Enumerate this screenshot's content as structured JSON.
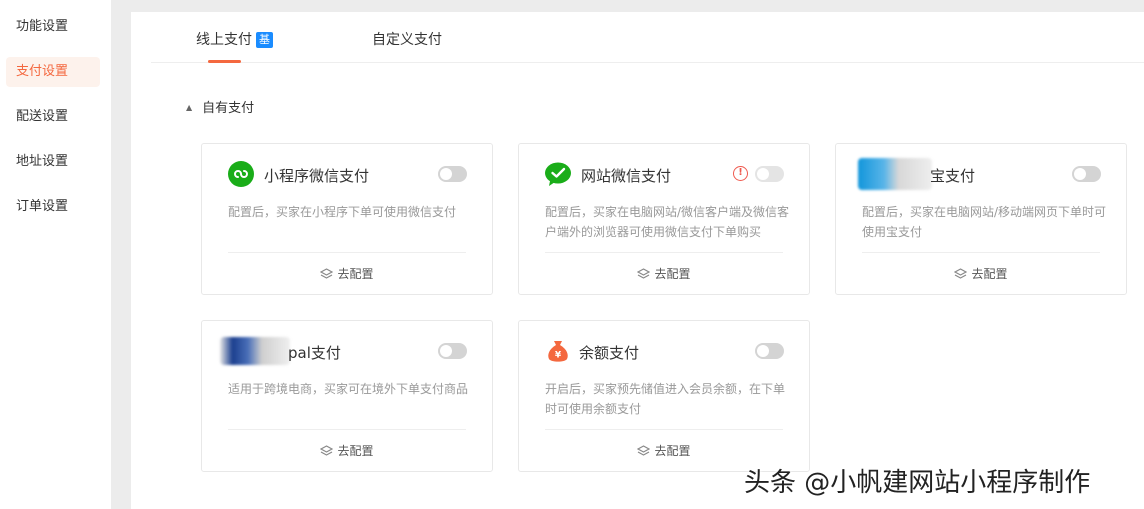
{
  "sidebar": {
    "items": [
      {
        "label": "功能设置"
      },
      {
        "label": "支付设置"
      },
      {
        "label": "配送设置"
      },
      {
        "label": "地址设置"
      },
      {
        "label": "订单设置"
      }
    ]
  },
  "tabs": [
    {
      "label": "线上支付",
      "badge": "基"
    },
    {
      "label": "自定义支付"
    }
  ],
  "section": {
    "label": "自有支付"
  },
  "cards": [
    {
      "title": "小程序微信支付",
      "desc": "配置后，买家在小程序下单可使用微信支付",
      "action": "去配置"
    },
    {
      "title": "网站微信支付",
      "desc": "配置后，买家在电脑网站/微信客户端及微信客户端外的浏览器可使用微信支付下单购买",
      "action": "去配置"
    },
    {
      "title": "宝支付",
      "desc": "配置后，买家在电脑网站/移动端网页下单时可使用宝支付",
      "action": "去配置"
    },
    {
      "title": "pal支付",
      "desc": "适用于跨境电商，买家可在境外下单支付商品",
      "action": "去配置"
    },
    {
      "title": "余额支付",
      "desc": "开启后，买家预先储值进入会员余额，在下单时可使用余额支付",
      "action": "去配置"
    }
  ],
  "watermark": "头条 @小帆建网站小程序制作",
  "colors": {
    "accent": "#f4683f",
    "badge": "#1a8cff",
    "wechat": "#1aad19",
    "warn": "#ef5a4f"
  }
}
